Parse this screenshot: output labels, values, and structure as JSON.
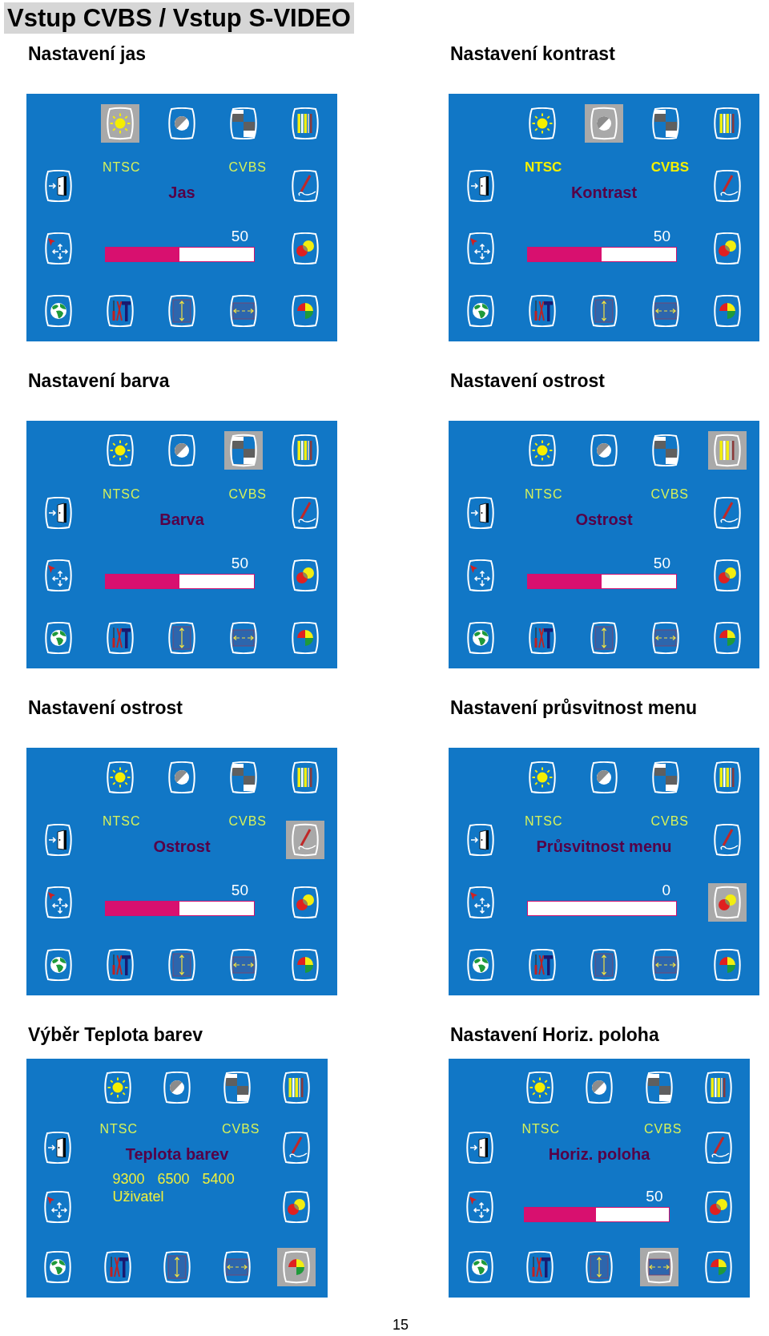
{
  "title": "Vstup CVBS / Vstup S-VIDEO",
  "screens": [
    {
      "heading": "Nastavení jas",
      "status_left": "NTSC",
      "status_right": "CVBS",
      "status_bold": false,
      "label": "Jas",
      "kind": "slider",
      "value": "50",
      "level": 0.5,
      "icons": [
        {
          "selected": true
        },
        {
          "selected": false
        },
        {
          "selected": false
        },
        {
          "selected": false
        },
        {
          "selected": false
        },
        {
          "selected": false
        },
        {
          "selected": false
        },
        {
          "selected": false
        },
        {
          "selected": false
        },
        {
          "selected": false
        },
        {
          "selected": false
        },
        {
          "selected": false
        },
        {
          "selected": false
        }
      ]
    },
    {
      "heading": "Nastavení kontrast",
      "status_left": "NTSC",
      "status_right": "CVBS",
      "status_bold": true,
      "label": "Kontrast",
      "kind": "slider",
      "value": "50",
      "level": 0.5,
      "icons": [
        {
          "selected": false
        },
        {
          "selected": true
        },
        {
          "selected": false
        },
        {
          "selected": false
        },
        {
          "selected": false
        },
        {
          "selected": false
        },
        {
          "selected": false
        },
        {
          "selected": false
        },
        {
          "selected": false
        },
        {
          "selected": false
        },
        {
          "selected": false
        },
        {
          "selected": false
        },
        {
          "selected": false
        }
      ]
    },
    {
      "heading": "Nastavení barva",
      "status_left": "NTSC",
      "status_right": "CVBS",
      "status_bold": false,
      "label": "Barva",
      "kind": "slider",
      "value": "50",
      "level": 0.5,
      "icons": [
        {
          "selected": false
        },
        {
          "selected": false
        },
        {
          "selected": true
        },
        {
          "selected": false
        },
        {
          "selected": false
        },
        {
          "selected": false
        },
        {
          "selected": false
        },
        {
          "selected": false
        },
        {
          "selected": false
        },
        {
          "selected": false
        },
        {
          "selected": false
        },
        {
          "selected": false
        },
        {
          "selected": false
        }
      ]
    },
    {
      "heading": "Nastavení ostrost",
      "status_left": "NTSC",
      "status_right": "CVBS",
      "status_bold": false,
      "label": "Ostrost",
      "kind": "slider",
      "value": "50",
      "level": 0.5,
      "icons": [
        {
          "selected": false
        },
        {
          "selected": false
        },
        {
          "selected": false
        },
        {
          "selected": true
        },
        {
          "selected": false
        },
        {
          "selected": false
        },
        {
          "selected": false
        },
        {
          "selected": false
        },
        {
          "selected": false
        },
        {
          "selected": false
        },
        {
          "selected": false
        },
        {
          "selected": false
        },
        {
          "selected": false
        }
      ]
    },
    {
      "heading": "Nastavení ostrost",
      "status_left": "NTSC",
      "status_right": "CVBS",
      "status_bold": false,
      "label": "Ostrost",
      "kind": "slider",
      "value": "50",
      "level": 0.5,
      "icons": [
        {
          "selected": false
        },
        {
          "selected": false
        },
        {
          "selected": false
        },
        {
          "selected": false
        },
        {
          "selected": false
        },
        {
          "selected": true
        },
        {
          "selected": false
        },
        {
          "selected": false
        },
        {
          "selected": false
        },
        {
          "selected": false
        },
        {
          "selected": false
        },
        {
          "selected": false
        },
        {
          "selected": false
        }
      ]
    },
    {
      "heading": "Nastavení průsvitnost menu",
      "status_left": "NTSC",
      "status_right": "CVBS",
      "status_bold": false,
      "label": "Průsvitnost menu",
      "kind": "slider",
      "value": "0",
      "level": 0,
      "icons": [
        {
          "selected": false
        },
        {
          "selected": false
        },
        {
          "selected": false
        },
        {
          "selected": false
        },
        {
          "selected": false
        },
        {
          "selected": false
        },
        {
          "selected": false
        },
        {
          "selected": true
        },
        {
          "selected": false
        },
        {
          "selected": false
        },
        {
          "selected": false
        },
        {
          "selected": false
        },
        {
          "selected": false
        }
      ]
    },
    {
      "heading": "Výběr Teplota barev",
      "status_left": "NTSC",
      "status_right": "CVBS",
      "status_bold": false,
      "label": "Teplota barev",
      "kind": "options",
      "options": [
        "9300",
        "6500",
        "5400",
        "Uživatel"
      ],
      "icons": [
        {
          "selected": false
        },
        {
          "selected": false
        },
        {
          "selected": false
        },
        {
          "selected": false
        },
        {
          "selected": false
        },
        {
          "selected": false
        },
        {
          "selected": false
        },
        {
          "selected": false
        },
        {
          "selected": false
        },
        {
          "selected": false
        },
        {
          "selected": false
        },
        {
          "selected": false
        },
        {
          "selected": true
        }
      ]
    },
    {
      "heading": "Nastavení Horiz. poloha",
      "status_left": "NTSC",
      "status_right": "CVBS",
      "status_bold": false,
      "label": "Horiz. poloha",
      "kind": "slider",
      "value": "50",
      "level": 0.5,
      "icons": [
        {
          "selected": false
        },
        {
          "selected": false
        },
        {
          "selected": false
        },
        {
          "selected": false
        },
        {
          "selected": false
        },
        {
          "selected": false
        },
        {
          "selected": false
        },
        {
          "selected": false
        },
        {
          "selected": false
        },
        {
          "selected": false
        },
        {
          "selected": false
        },
        {
          "selected": true
        },
        {
          "selected": false
        }
      ]
    }
  ],
  "page_number": "15"
}
